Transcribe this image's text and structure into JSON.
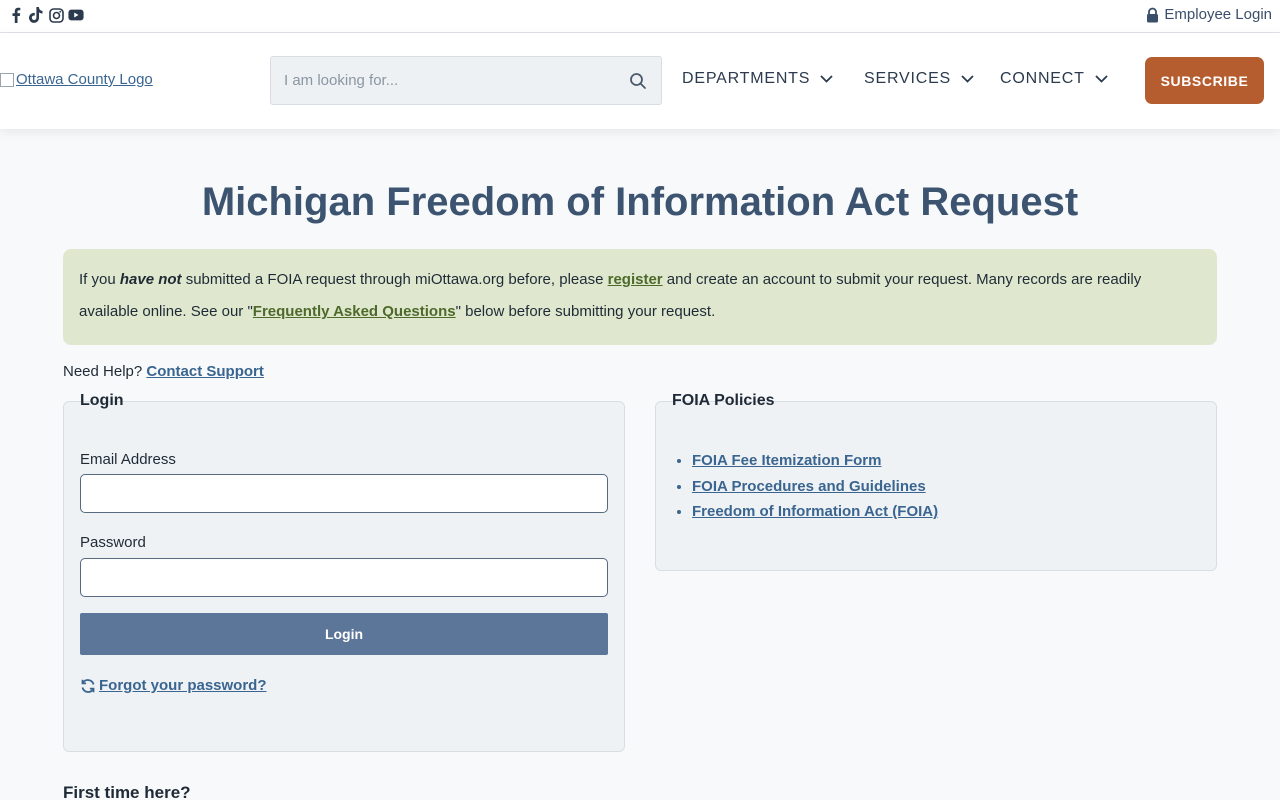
{
  "topbar": {
    "social_icons": [
      "facebook-icon",
      "tiktok-icon",
      "instagram-icon",
      "youtube-icon"
    ],
    "employee_login": "Employee Login"
  },
  "header": {
    "logo_alt": "Ottawa County Logo",
    "search_placeholder": "I am looking for...",
    "nav": [
      {
        "label": "DEPARTMENTS"
      },
      {
        "label": "SERVICES"
      },
      {
        "label": "CONNECT"
      }
    ],
    "subscribe": "SUBSCRIBE"
  },
  "main": {
    "title": "Michigan Freedom of Information Act Request",
    "notice": {
      "p1": "If you ",
      "em": "have not",
      "p2": " submitted a FOIA request through miOttawa.org before, please ",
      "register_link": "register",
      "p3": " and create an account to submit your request. Many records are readily available online. See our \"",
      "faq_link": "Frequently Asked Questions",
      "p4": "\" below before submitting your request."
    },
    "help": {
      "label": "Need Help? ",
      "link": "Contact Support"
    },
    "login": {
      "legend": "Login",
      "email_label": "Email Address",
      "email_value": "",
      "password_label": "Password",
      "password_value": "",
      "button": "Login",
      "forgot": "Forgot your password?"
    },
    "policies": {
      "legend": "FOIA Policies",
      "items": [
        "FOIA Fee Itemization Form",
        "FOIA Procedures and Guidelines",
        "Freedom of Information Act (FOIA)"
      ]
    },
    "first_time": "First time here?"
  },
  "colors": {
    "title": "#3d5470",
    "subscribe_bg": "#b65d2f",
    "login_button_bg": "#5c7699",
    "notice_bg": "#dfe8cf",
    "link": "#3a6590"
  }
}
